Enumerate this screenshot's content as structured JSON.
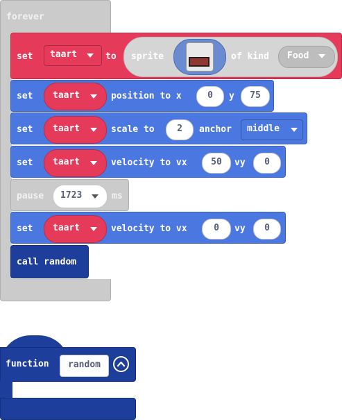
{
  "forever": {
    "label": "forever"
  },
  "set_sprite": {
    "set_label": "set",
    "variable": "taart",
    "to_label": "to",
    "sprite_label": "sprite",
    "of_kind_label": "of kind",
    "kind": "Food"
  },
  "set_position": {
    "set_label": "set",
    "variable": "taart",
    "label": "position to x",
    "x": "0",
    "y_label": "y",
    "y": "75"
  },
  "set_scale": {
    "set_label": "set",
    "variable": "taart",
    "label": "scale to",
    "scale": "2",
    "anchor_label": "anchor",
    "anchor": "middle"
  },
  "set_velocity_1": {
    "set_label": "set",
    "variable": "taart",
    "label": "velocity to vx",
    "vx": "50",
    "vy_label": "vy",
    "vy": "0"
  },
  "pause": {
    "label": "pause",
    "value": "1723",
    "unit": "ms"
  },
  "set_velocity_2": {
    "set_label": "set",
    "variable": "taart",
    "label": "velocity to vx",
    "vx": "0",
    "vy_label": "vy",
    "vy": "0"
  },
  "call": {
    "label": "call random"
  },
  "function_def": {
    "label": "function",
    "name": "random"
  },
  "colors": {
    "sprites_red": "#e53a5a",
    "motion_blue": "#4b78e0",
    "function_navy": "#1e3e9b",
    "loops_gray": "#cbcbcb"
  }
}
